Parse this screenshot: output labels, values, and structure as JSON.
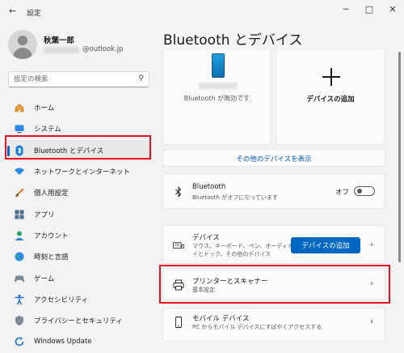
{
  "window": {
    "title": "設定",
    "back_glyph": "←",
    "minimize_glyph": "─",
    "maximize_glyph": "□",
    "close_glyph": "✕"
  },
  "profile": {
    "name": "秋葉一郎",
    "email_domain": "@outlook.jp"
  },
  "search": {
    "placeholder": "設定の検索",
    "icon_glyph": "⚲"
  },
  "nav": {
    "items": [
      {
        "label": "ホーム",
        "icon": "home-icon"
      },
      {
        "label": "システム",
        "icon": "system-icon"
      },
      {
        "label": "Bluetooth とデバイス",
        "icon": "bluetooth-icon",
        "active": true
      },
      {
        "label": "ネットワークとインターネット",
        "icon": "wifi-icon"
      },
      {
        "label": "個人用設定",
        "icon": "brush-icon"
      },
      {
        "label": "アプリ",
        "icon": "apps-icon"
      },
      {
        "label": "アカウント",
        "icon": "account-icon"
      },
      {
        "label": "時刻と言語",
        "icon": "globe-icon"
      },
      {
        "label": "ゲーム",
        "icon": "gamepad-icon"
      },
      {
        "label": "アクセシビリティ",
        "icon": "accessibility-icon"
      },
      {
        "label": "プライバシーとセキュリティ",
        "icon": "shield-icon"
      },
      {
        "label": "Windows Update",
        "icon": "update-icon"
      }
    ]
  },
  "main": {
    "title": "Bluetooth とデバイス",
    "device_card": {
      "status": "Bluetooth が無効です"
    },
    "add_device_card": {
      "label": "デバイスの追加"
    },
    "more_devices_link": "その他のデバイスを表示",
    "bluetooth_row": {
      "title": "Bluetooth",
      "subtitle": "Bluetooth がオフになっています",
      "toggle_label": "オフ",
      "toggle_on": false
    },
    "devices_row": {
      "title": "デバイス",
      "subtitle_line1": "マウス、キーボード、ペン、オーディオ、ディスプレ",
      "subtitle_line2": "イとドック、その他のデバイス",
      "button_label": "デバイスの追加"
    },
    "printers_row": {
      "title": "プリンターとスキャナー",
      "subtitle": "基本設定"
    },
    "mobile_row": {
      "title": "モバイル デバイス",
      "subtitle": "PC からモバイル デバイスにすばやくアクセスする"
    },
    "chevron_glyph": "›"
  },
  "colors": {
    "accent": "#0067c0",
    "highlight_box": "#e81123"
  }
}
